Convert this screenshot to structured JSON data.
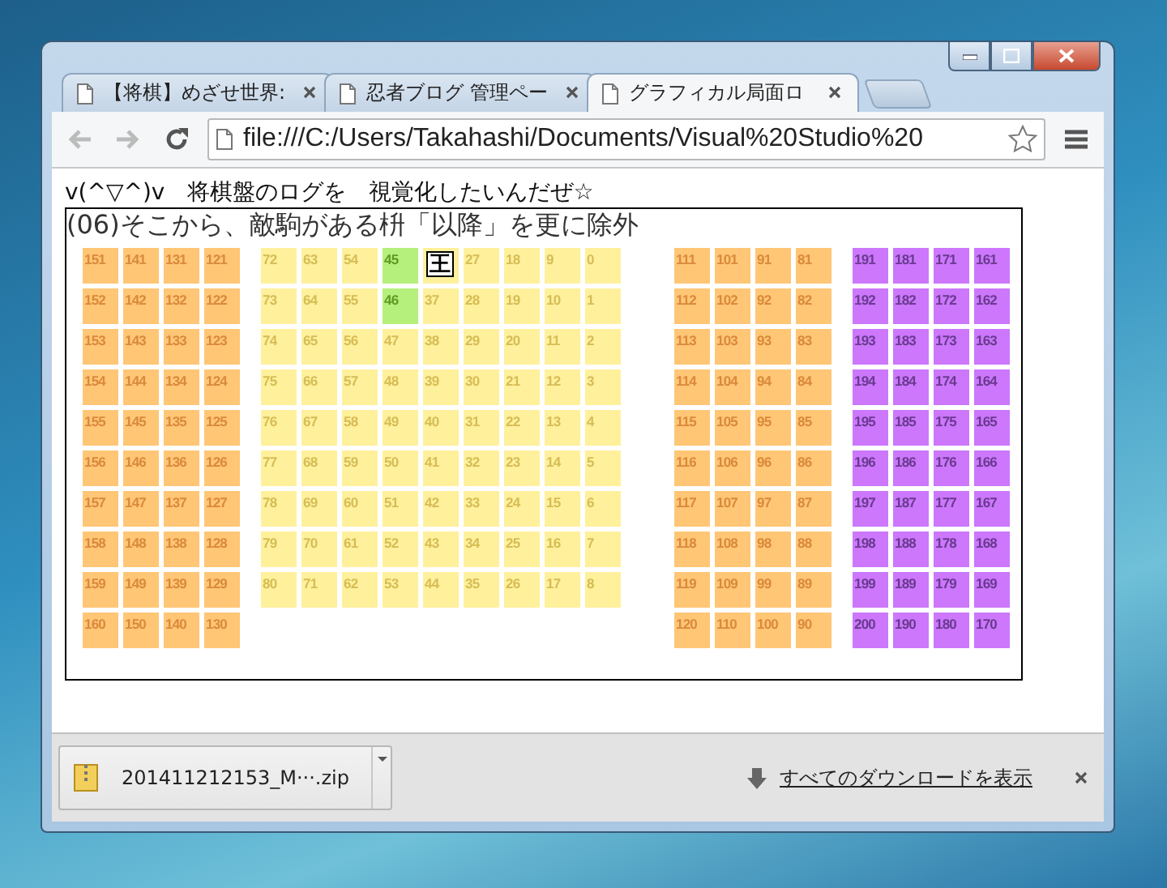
{
  "browser": {
    "tabs": [
      {
        "title": "【将棋】めざせ世界:",
        "selected": false
      },
      {
        "title": "忍者ブログ 管理ペー",
        "selected": false
      },
      {
        "title": "グラフィカル局面ロ",
        "selected": true
      }
    ],
    "address": "file:///C:/Users/Takahashi/Documents/Visual%20Studio%20"
  },
  "page": {
    "tagline": "v(^▽^)v　将棋盤のログを　視覚化したいんだぜ☆",
    "heading": "(06)そこから、敵駒がある枡「以降」を更に除外",
    "blocks": [
      {
        "kind": "hand",
        "color": "#ffc676",
        "columns": [
          [
            {
              "label": "151",
              "highlighted": false
            },
            {
              "label": "152",
              "highlighted": false
            },
            {
              "label": "153",
              "highlighted": false
            },
            {
              "label": "154",
              "highlighted": false
            },
            {
              "label": "155",
              "highlighted": false
            },
            {
              "label": "156",
              "highlighted": false
            },
            {
              "label": "157",
              "highlighted": false
            },
            {
              "label": "158",
              "highlighted": false
            },
            {
              "label": "159",
              "highlighted": false
            },
            {
              "label": "160",
              "highlighted": false
            }
          ],
          [
            {
              "label": "141",
              "highlighted": false
            },
            {
              "label": "142",
              "highlighted": false
            },
            {
              "label": "143",
              "highlighted": false
            },
            {
              "label": "144",
              "highlighted": false
            },
            {
              "label": "145",
              "highlighted": false
            },
            {
              "label": "146",
              "highlighted": false
            },
            {
              "label": "147",
              "highlighted": false
            },
            {
              "label": "148",
              "highlighted": false
            },
            {
              "label": "149",
              "highlighted": false
            },
            {
              "label": "150",
              "highlighted": false
            }
          ],
          [
            {
              "label": "131",
              "highlighted": false
            },
            {
              "label": "132",
              "highlighted": false
            },
            {
              "label": "133",
              "highlighted": false
            },
            {
              "label": "134",
              "highlighted": false
            },
            {
              "label": "135",
              "highlighted": false
            },
            {
              "label": "136",
              "highlighted": false
            },
            {
              "label": "137",
              "highlighted": false
            },
            {
              "label": "138",
              "highlighted": false
            },
            {
              "label": "139",
              "highlighted": false
            },
            {
              "label": "140",
              "highlighted": false
            }
          ],
          [
            {
              "label": "121",
              "highlighted": false
            },
            {
              "label": "122",
              "highlighted": false
            },
            {
              "label": "123",
              "highlighted": false
            },
            {
              "label": "124",
              "highlighted": false
            },
            {
              "label": "125",
              "highlighted": false
            },
            {
              "label": "126",
              "highlighted": false
            },
            {
              "label": "127",
              "highlighted": false
            },
            {
              "label": "128",
              "highlighted": false
            },
            {
              "label": "129",
              "highlighted": false
            },
            {
              "label": "130",
              "highlighted": false
            }
          ]
        ]
      },
      {
        "kind": "board",
        "color": "#fff09c",
        "columns": [
          [
            {
              "label": "72",
              "highlighted": false
            },
            {
              "label": "73",
              "highlighted": false
            },
            {
              "label": "74",
              "highlighted": false
            },
            {
              "label": "75",
              "highlighted": false
            },
            {
              "label": "76",
              "highlighted": false
            },
            {
              "label": "77",
              "highlighted": false
            },
            {
              "label": "78",
              "highlighted": false
            },
            {
              "label": "79",
              "highlighted": false
            },
            {
              "label": "80",
              "highlighted": false
            }
          ],
          [
            {
              "label": "63",
              "highlighted": false
            },
            {
              "label": "64",
              "highlighted": false
            },
            {
              "label": "65",
              "highlighted": false
            },
            {
              "label": "66",
              "highlighted": false
            },
            {
              "label": "67",
              "highlighted": false
            },
            {
              "label": "68",
              "highlighted": false
            },
            {
              "label": "69",
              "highlighted": false
            },
            {
              "label": "70",
              "highlighted": false
            },
            {
              "label": "71",
              "highlighted": false
            }
          ],
          [
            {
              "label": "54",
              "highlighted": false
            },
            {
              "label": "55",
              "highlighted": false
            },
            {
              "label": "56",
              "highlighted": false
            },
            {
              "label": "57",
              "highlighted": false
            },
            {
              "label": "58",
              "highlighted": false
            },
            {
              "label": "59",
              "highlighted": false
            },
            {
              "label": "60",
              "highlighted": false
            },
            {
              "label": "61",
              "highlighted": false
            },
            {
              "label": "62",
              "highlighted": false
            }
          ],
          [
            {
              "label": "45",
              "highlighted": true
            },
            {
              "label": "46",
              "highlighted": true
            },
            {
              "label": "47",
              "highlighted": false
            },
            {
              "label": "48",
              "highlighted": false
            },
            {
              "label": "49",
              "highlighted": false
            },
            {
              "label": "50",
              "highlighted": false
            },
            {
              "label": "51",
              "highlighted": false
            },
            {
              "label": "52",
              "highlighted": false
            },
            {
              "label": "53",
              "highlighted": false
            }
          ],
          [
            {
              "piece": "王",
              "highlighted": false
            },
            {
              "label": "37",
              "highlighted": false
            },
            {
              "label": "38",
              "highlighted": false
            },
            {
              "label": "39",
              "highlighted": false
            },
            {
              "label": "40",
              "highlighted": false
            },
            {
              "label": "41",
              "highlighted": false
            },
            {
              "label": "42",
              "highlighted": false
            },
            {
              "label": "43",
              "highlighted": false
            },
            {
              "label": "44",
              "highlighted": false
            }
          ],
          [
            {
              "label": "27",
              "highlighted": false
            },
            {
              "label": "28",
              "highlighted": false
            },
            {
              "label": "29",
              "highlighted": false
            },
            {
              "label": "30",
              "highlighted": false
            },
            {
              "label": "31",
              "highlighted": false
            },
            {
              "label": "32",
              "highlighted": false
            },
            {
              "label": "33",
              "highlighted": false
            },
            {
              "label": "34",
              "highlighted": false
            },
            {
              "label": "35",
              "highlighted": false
            }
          ],
          [
            {
              "label": "18",
              "highlighted": false
            },
            {
              "label": "19",
              "highlighted": false
            },
            {
              "label": "20",
              "highlighted": false
            },
            {
              "label": "21",
              "highlighted": false
            },
            {
              "label": "22",
              "highlighted": false
            },
            {
              "label": "23",
              "highlighted": false
            },
            {
              "label": "24",
              "highlighted": false
            },
            {
              "label": "25",
              "highlighted": false
            },
            {
              "label": "26",
              "highlighted": false
            }
          ],
          [
            {
              "label": "9",
              "highlighted": false
            },
            {
              "label": "10",
              "highlighted": false
            },
            {
              "label": "11",
              "highlighted": false
            },
            {
              "label": "12",
              "highlighted": false
            },
            {
              "label": "13",
              "highlighted": false
            },
            {
              "label": "14",
              "highlighted": false
            },
            {
              "label": "15",
              "highlighted": false
            },
            {
              "label": "16",
              "highlighted": false
            },
            {
              "label": "17",
              "highlighted": false
            }
          ],
          [
            {
              "label": "0",
              "highlighted": false
            },
            {
              "label": "1",
              "highlighted": false
            },
            {
              "label": "2",
              "highlighted": false
            },
            {
              "label": "3",
              "highlighted": false
            },
            {
              "label": "4",
              "highlighted": false
            },
            {
              "label": "5",
              "highlighted": false
            },
            {
              "label": "6",
              "highlighted": false
            },
            {
              "label": "7",
              "highlighted": false
            },
            {
              "label": "8",
              "highlighted": false
            }
          ]
        ]
      },
      {
        "kind": "hand",
        "color": "#ffc676",
        "columns": [
          [
            {
              "label": "111",
              "highlighted": false
            },
            {
              "label": "112",
              "highlighted": false
            },
            {
              "label": "113",
              "highlighted": false
            },
            {
              "label": "114",
              "highlighted": false
            },
            {
              "label": "115",
              "highlighted": false
            },
            {
              "label": "116",
              "highlighted": false
            },
            {
              "label": "117",
              "highlighted": false
            },
            {
              "label": "118",
              "highlighted": false
            },
            {
              "label": "119",
              "highlighted": false
            },
            {
              "label": "120",
              "highlighted": false
            }
          ],
          [
            {
              "label": "101",
              "highlighted": false
            },
            {
              "label": "102",
              "highlighted": false
            },
            {
              "label": "103",
              "highlighted": false
            },
            {
              "label": "104",
              "highlighted": false
            },
            {
              "label": "105",
              "highlighted": false
            },
            {
              "label": "106",
              "highlighted": false
            },
            {
              "label": "107",
              "highlighted": false
            },
            {
              "label": "108",
              "highlighted": false
            },
            {
              "label": "109",
              "highlighted": false
            },
            {
              "label": "110",
              "highlighted": false
            }
          ],
          [
            {
              "label": "91",
              "highlighted": false
            },
            {
              "label": "92",
              "highlighted": false
            },
            {
              "label": "93",
              "highlighted": false
            },
            {
              "label": "94",
              "highlighted": false
            },
            {
              "label": "95",
              "highlighted": false
            },
            {
              "label": "96",
              "highlighted": false
            },
            {
              "label": "97",
              "highlighted": false
            },
            {
              "label": "98",
              "highlighted": false
            },
            {
              "label": "99",
              "highlighted": false
            },
            {
              "label": "100",
              "highlighted": false
            }
          ],
          [
            {
              "label": "81",
              "highlighted": false
            },
            {
              "label": "82",
              "highlighted": false
            },
            {
              "label": "83",
              "highlighted": false
            },
            {
              "label": "84",
              "highlighted": false
            },
            {
              "label": "85",
              "highlighted": false
            },
            {
              "label": "86",
              "highlighted": false
            },
            {
              "label": "87",
              "highlighted": false
            },
            {
              "label": "88",
              "highlighted": false
            },
            {
              "label": "89",
              "highlighted": false
            },
            {
              "label": "90",
              "highlighted": false
            }
          ]
        ]
      },
      {
        "kind": "extra",
        "color": "#cc77fc",
        "columns": [
          [
            {
              "label": "191",
              "highlighted": false
            },
            {
              "label": "192",
              "highlighted": false
            },
            {
              "label": "193",
              "highlighted": false
            },
            {
              "label": "194",
              "highlighted": false
            },
            {
              "label": "195",
              "highlighted": false
            },
            {
              "label": "196",
              "highlighted": false
            },
            {
              "label": "197",
              "highlighted": false
            },
            {
              "label": "198",
              "highlighted": false
            },
            {
              "label": "199",
              "highlighted": false
            },
            {
              "label": "200",
              "highlighted": false
            }
          ],
          [
            {
              "label": "181",
              "highlighted": false
            },
            {
              "label": "182",
              "highlighted": false
            },
            {
              "label": "183",
              "highlighted": false
            },
            {
              "label": "184",
              "highlighted": false
            },
            {
              "label": "185",
              "highlighted": false
            },
            {
              "label": "186",
              "highlighted": false
            },
            {
              "label": "187",
              "highlighted": false
            },
            {
              "label": "188",
              "highlighted": false
            },
            {
              "label": "189",
              "highlighted": false
            },
            {
              "label": "190",
              "highlighted": false
            }
          ],
          [
            {
              "label": "171",
              "highlighted": false
            },
            {
              "label": "172",
              "highlighted": false
            },
            {
              "label": "173",
              "highlighted": false
            },
            {
              "label": "174",
              "highlighted": false
            },
            {
              "label": "175",
              "highlighted": false
            },
            {
              "label": "176",
              "highlighted": false
            },
            {
              "label": "177",
              "highlighted": false
            },
            {
              "label": "178",
              "highlighted": false
            },
            {
              "label": "179",
              "highlighted": false
            },
            {
              "label": "180",
              "highlighted": false
            }
          ],
          [
            {
              "label": "161",
              "highlighted": false
            },
            {
              "label": "162",
              "highlighted": false
            },
            {
              "label": "163",
              "highlighted": false
            },
            {
              "label": "164",
              "highlighted": false
            },
            {
              "label": "165",
              "highlighted": false
            },
            {
              "label": "166",
              "highlighted": false
            },
            {
              "label": "167",
              "highlighted": false
            },
            {
              "label": "168",
              "highlighted": false
            },
            {
              "label": "169",
              "highlighted": false
            },
            {
              "label": "170",
              "highlighted": false
            }
          ]
        ]
      }
    ]
  },
  "download_bar": {
    "file": "201411212153_M···.zip",
    "show_all": "すべてのダウンロードを表示"
  }
}
